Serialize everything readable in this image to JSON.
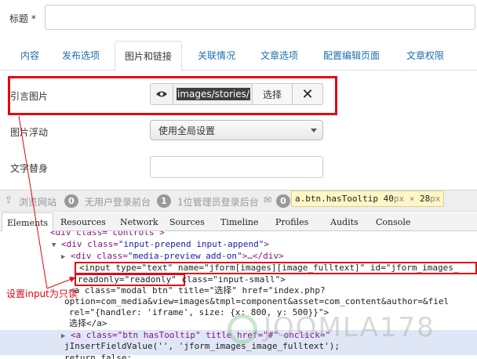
{
  "form": {
    "title_label": "标题 *",
    "tabs": [
      "内容",
      "发布选项",
      "图片和链接",
      "关联情况",
      "文章选项",
      "配置编辑页面",
      "文章权限"
    ],
    "active_tab": "图片和链接",
    "intro_image_label": "引言图片",
    "intro_image_value": "images/stories/",
    "select_button": "选择",
    "clear_icon": "close-icon",
    "float_label": "图片浮动",
    "float_value": "使用全局设置",
    "alt_label": "文字替身"
  },
  "statusbar": {
    "browse_site": "浏览网站",
    "front_count": "0",
    "front_text": "无用户登录前台",
    "admin_count": "1",
    "admin_text": "1位管理员登录后台",
    "msg_count": "0"
  },
  "tooltip": {
    "selector": "a.btn.hasTooltip",
    "w": "40",
    "unit1": "px",
    "x": "×",
    "h": "28",
    "unit2": "px"
  },
  "devtools": {
    "tabs": [
      "Elements",
      "Resources",
      "Network",
      "Sources",
      "Timeline",
      "Profiles",
      "Audits",
      "Console"
    ],
    "active": "Elements",
    "lines": {
      "l0": "<div class=\"controls\">",
      "l1a": "<div class=",
      "l1b": "\"input-prepend input-append\"",
      "l1c": ">",
      "l2a": "<div class=",
      "l2b": "\"media-preview add-on\"",
      "l2c": ">…</div>",
      "l3": "<input type=\"text\" name=\"jform[images][image_fulltext]\" id=\"jform_images_",
      "l4a": "readonly=\"readonly\"",
      "l4b": " class=\"input-small\">",
      "l5": "<a class=\"modal btn\" title=\"选择\" href=\"index.php?",
      "l6": "option=com_media&view=images&tmpl=component&asset=com_content&author=&fiel",
      "l7": "rel=\"{handler: 'iframe', size: {x: 800, y: 500}}\">",
      "l8": "选择</a>",
      "l9": "<a class=\"btn hasTooltip\" title href=\"#\" onclick=\"",
      "l10": "jInsertFieldValue('', 'jform_images_image_fulltext');",
      "l11": "return false;"
    }
  },
  "annotation": "设置input为只读",
  "watermark": "JOOMLA178",
  "colors": {
    "accent_red": "#e30613",
    "link_blue": "#1a6fb0"
  }
}
